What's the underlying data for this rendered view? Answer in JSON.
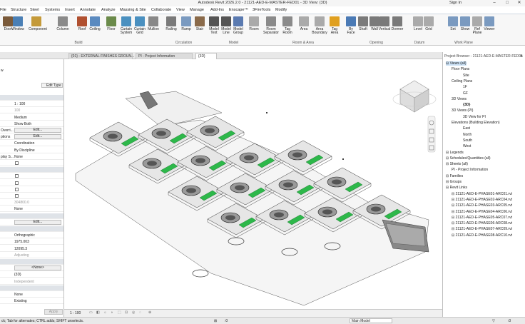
{
  "titlebar": {
    "title": "Autodesk Revit 2026.2.0 - 21121-AED-E-MASTER-FED01 - 3D View: {3D}",
    "signin": "Sign In"
  },
  "menu": {
    "tabs": [
      "File",
      "Structure",
      "Steel",
      "Systems",
      "Insert",
      "Annotate",
      "Analyze",
      "Massing & Site",
      "Collaborate",
      "View",
      "Manage",
      "Add-Ins",
      "Enscape™",
      "3FireTools",
      "Modify"
    ]
  },
  "ribbon": {
    "buttons": [
      {
        "label": "Door",
        "icon": "door-icon",
        "color": "#7a5a3a"
      },
      {
        "label": "Window",
        "icon": "window-icon",
        "color": "#4a7fb5"
      },
      {
        "label": "Component",
        "icon": "component-icon",
        "color": "#c49a3a"
      },
      {
        "label": "Column",
        "icon": "column-icon",
        "color": "#8a8a8a"
      },
      {
        "label": "Roof",
        "icon": "roof-icon",
        "color": "#b05030"
      },
      {
        "label": "Ceiling",
        "icon": "ceiling-icon",
        "color": "#5a8ac0"
      },
      {
        "label": "Floor",
        "icon": "floor-icon",
        "color": "#6a8a4a"
      },
      {
        "label": "Curtain\nSystem",
        "icon": "curtain-system-icon",
        "color": "#4a90c0"
      },
      {
        "label": "Curtain\nGrid",
        "icon": "curtain-grid-icon",
        "color": "#4a90c0"
      },
      {
        "label": "Mullion",
        "icon": "mullion-icon",
        "color": "#888888"
      },
      {
        "label": "Railing",
        "icon": "railing-icon",
        "color": "#7a7a7a"
      },
      {
        "label": "Ramp",
        "icon": "ramp-icon",
        "color": "#7a9ac0"
      },
      {
        "label": "Stair",
        "icon": "stair-icon",
        "color": "#8a6a4a"
      },
      {
        "label": "Model\nText",
        "icon": "model-text-icon",
        "color": "#555555"
      },
      {
        "label": "Model\nLine",
        "icon": "model-line-icon",
        "color": "#555555"
      },
      {
        "label": "Model\nGroup",
        "icon": "model-group-icon",
        "color": "#5a7ab0"
      },
      {
        "label": "Room",
        "icon": "room-icon",
        "color": "#aaaaaa"
      },
      {
        "label": "Room\nSeparator",
        "icon": "room-separator-icon",
        "color": "#8a8a8a"
      },
      {
        "label": "Tag\nRoom",
        "icon": "tag-room-icon",
        "color": "#8a8a8a"
      },
      {
        "label": "Area",
        "icon": "area-icon",
        "color": "#aaaaaa"
      },
      {
        "label": "Area\nBoundary",
        "icon": "area-boundary-icon",
        "color": "#aaaaaa"
      },
      {
        "label": "Tag\nArea",
        "icon": "tag-area-icon",
        "color": "#e0a020"
      },
      {
        "label": "By\nFace",
        "icon": "by-face-icon",
        "color": "#4a7ab5"
      },
      {
        "label": "Shaft",
        "icon": "shaft-icon",
        "color": "#7a7a7a"
      },
      {
        "label": "Wall",
        "icon": "wall-opening-icon",
        "color": "#7a7a7a"
      },
      {
        "label": "Vertical",
        "icon": "vertical-opening-icon",
        "color": "#7a7a7a"
      },
      {
        "label": "Dormer",
        "icon": "dormer-icon",
        "color": "#7a7a7a"
      },
      {
        "label": "Level",
        "icon": "level-icon",
        "color": "#aaaaaa"
      },
      {
        "label": "Grid",
        "icon": "grid-icon",
        "color": "#aaaaaa"
      },
      {
        "label": "Set",
        "icon": "set-icon",
        "color": "#7a9ac0"
      },
      {
        "label": "Show",
        "icon": "show-icon",
        "color": "#7a9ac0"
      },
      {
        "label": "Ref\nPlane",
        "icon": "ref-plane-icon",
        "color": "#aaaaaa"
      },
      {
        "label": "Viewer",
        "icon": "viewer-icon",
        "color": "#7a9ac0"
      }
    ],
    "groups": [
      "Build",
      "Circulation",
      "Model",
      "Room & Area",
      "Opening",
      "Datum",
      "Work Plane"
    ]
  },
  "tabs": [
    {
      "label": "{01} - EXTERNAL FINISHES GROUN..."
    },
    {
      "label": "PI - Project Information"
    },
    {
      "label": "{3D}"
    }
  ],
  "properties": {
    "edit_type": "Edit Type",
    "rows": [
      {
        "k": "",
        "v": "",
        "type": "sec"
      },
      {
        "k": "",
        "v": "1 : 100",
        "type": "val"
      },
      {
        "k": "",
        "v": "100",
        "type": "dim"
      },
      {
        "k": "",
        "v": "Medium",
        "type": "val"
      },
      {
        "k": "",
        "v": "Show Both",
        "type": "val"
      },
      {
        "k": "Overri...",
        "v": "Edit...",
        "type": "btn"
      },
      {
        "k": "ptions",
        "v": "Edit...",
        "type": "btn"
      },
      {
        "k": "",
        "v": "Coordination",
        "type": "val"
      },
      {
        "k": "",
        "v": "By Discipline",
        "type": "val"
      },
      {
        "k": "play S...",
        "v": "None",
        "type": "val"
      },
      {
        "k": "",
        "v": "",
        "type": "cb"
      },
      {
        "k": "",
        "v": "",
        "type": "sec"
      },
      {
        "k": "",
        "v": "",
        "type": "cb"
      },
      {
        "k": "",
        "v": "",
        "type": "cb"
      },
      {
        "k": "",
        "v": "",
        "type": "cb"
      },
      {
        "k": "",
        "v": "",
        "type": "cb"
      },
      {
        "k": "",
        "v": "304800.0",
        "type": "dim"
      },
      {
        "k": "",
        "v": "None",
        "type": "val"
      },
      {
        "k": "",
        "v": "",
        "type": "sec"
      },
      {
        "k": "",
        "v": "Edit...",
        "type": "btn"
      },
      {
        "k": "",
        "v": "",
        "type": "sec"
      },
      {
        "k": "",
        "v": "Orthographic",
        "type": "val"
      },
      {
        "k": "",
        "v": "1975.003",
        "type": "val"
      },
      {
        "k": "",
        "v": "12095.3",
        "type": "val"
      },
      {
        "k": "",
        "v": "Adjusting",
        "type": "dim"
      },
      {
        "k": "",
        "v": "",
        "type": "sec"
      },
      {
        "k": "",
        "v": "<None>",
        "type": "btn"
      },
      {
        "k": "",
        "v": "{3D}",
        "type": "val"
      },
      {
        "k": "",
        "v": "Independent",
        "type": "dim"
      },
      {
        "k": "",
        "v": "",
        "type": "sec"
      },
      {
        "k": "",
        "v": "None",
        "type": "val"
      },
      {
        "k": "",
        "v": "Existing",
        "type": "val"
      }
    ],
    "apply": "Apply"
  },
  "browser": {
    "title": "Project Browser - 21121-AED-E-MASTER-FED01",
    "items": [
      {
        "label": "Views (all)",
        "indent": 0,
        "selected": true
      },
      {
        "label": "Floor Plans",
        "indent": 1
      },
      {
        "label": "Site",
        "indent": 3
      },
      {
        "label": "Ceiling Plans",
        "indent": 1
      },
      {
        "label": "1F",
        "indent": 3
      },
      {
        "label": "GF",
        "indent": 3
      },
      {
        "label": "3D Views",
        "indent": 1
      },
      {
        "label": "{3D}",
        "indent": 3,
        "bold": true
      },
      {
        "label": "3D Views (PI)",
        "indent": 1
      },
      {
        "label": "3D View for PI",
        "indent": 3
      },
      {
        "label": "Elevations (Building Elevation)",
        "indent": 1
      },
      {
        "label": "East",
        "indent": 3
      },
      {
        "label": "North",
        "indent": 3
      },
      {
        "label": "South",
        "indent": 3
      },
      {
        "label": "West",
        "indent": 3
      },
      {
        "label": "Legends",
        "indent": 0
      },
      {
        "label": "Schedules/Quantities (all)",
        "indent": 0
      },
      {
        "label": "Sheets (all)",
        "indent": 0
      },
      {
        "label": "PI - Project Information",
        "indent": 1
      },
      {
        "label": "Families",
        "indent": 0
      },
      {
        "label": "Groups",
        "indent": 0
      },
      {
        "label": "Revit Links",
        "indent": 0
      },
      {
        "label": "21121-AED-E-PHASE01-ARC01.rvt",
        "indent": 1
      },
      {
        "label": "21121-AED-E-PHASE02-ARC04.rvt",
        "indent": 1
      },
      {
        "label": "21121-AED-E-PHASE03-ARC05.rvt",
        "indent": 1
      },
      {
        "label": "21121-AED-E-PHASE04-ARC06.rvt",
        "indent": 1
      },
      {
        "label": "21121-AED-E-PHASE05-ARC07.rvt",
        "indent": 1
      },
      {
        "label": "21121-AED-E-PHASE06-ARC08.rvt",
        "indent": 1
      },
      {
        "label": "21121-AED-E-PHASE07-ARC09.rvt",
        "indent": 1
      },
      {
        "label": "21121-AED-E-PHASE08-ARC10.rvt",
        "indent": 1
      }
    ]
  },
  "viewcontrol": {
    "scale": "1 : 100"
  },
  "status": {
    "message": "ck; Tab for alternates; CTRL adds; SHIFT unselects.",
    "model": "Main Model",
    "zero": ":0"
  },
  "colors": {
    "accent": "#2b73c4",
    "floor_green": "#2db84a",
    "selection": "#cde3f7"
  }
}
